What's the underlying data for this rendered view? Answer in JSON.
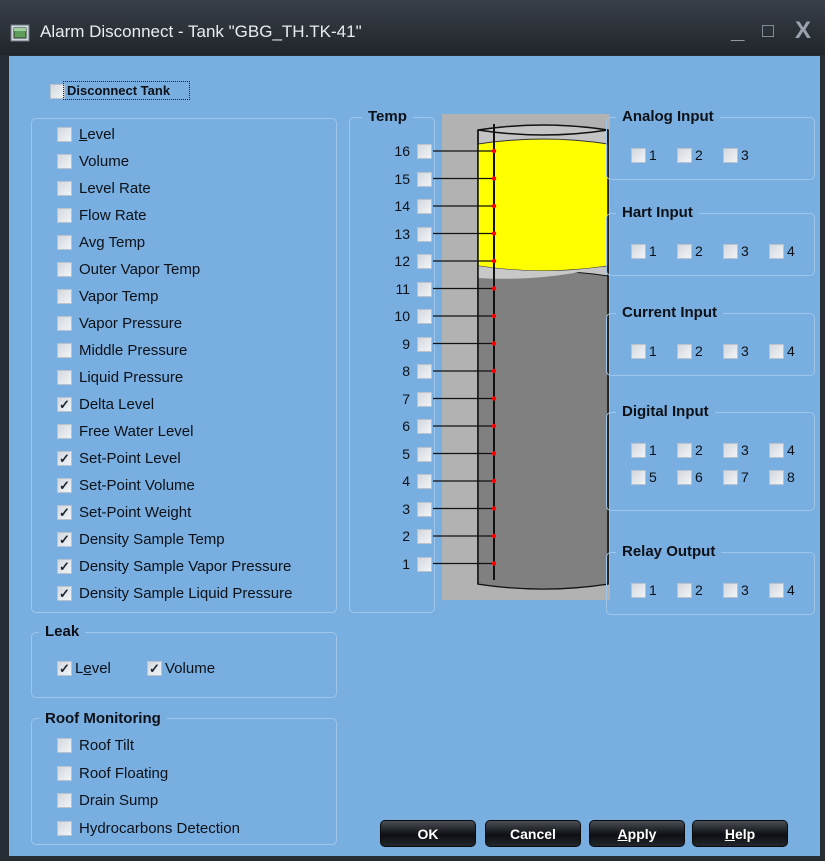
{
  "window": {
    "title": "Alarm Disconnect - Tank \"GBG_TH.TK-41\"",
    "minimize_glyph": "_",
    "maximize_glyph": "□",
    "close_glyph": "X",
    "icon": "tank-icon"
  },
  "disconnect_tank": {
    "label": "Disconnect Tank",
    "checked": false
  },
  "main_alarms": [
    {
      "label": "Level",
      "mnemonic": "L",
      "checked": false
    },
    {
      "label": "Volume",
      "checked": false
    },
    {
      "label": "Level Rate",
      "checked": false
    },
    {
      "label": "Flow Rate",
      "checked": false
    },
    {
      "label": "Avg Temp",
      "checked": false
    },
    {
      "label": "Outer Vapor Temp",
      "checked": false
    },
    {
      "label": "Vapor Temp",
      "checked": false
    },
    {
      "label": "Vapor Pressure",
      "checked": false
    },
    {
      "label": "Middle Pressure",
      "checked": false
    },
    {
      "label": "Liquid Pressure",
      "checked": false
    },
    {
      "label": "Delta Level",
      "checked": true
    },
    {
      "label": "Free  Water Level",
      "checked": false
    },
    {
      "label": "Set-Point Level",
      "checked": true
    },
    {
      "label": "Set-Point Volume",
      "checked": true
    },
    {
      "label": "Set-Point Weight",
      "checked": true
    },
    {
      "label": "Density Sample Temp",
      "checked": true
    },
    {
      "label": "Density Sample Vapor Pressure",
      "checked": true
    },
    {
      "label": "Density Sample Liquid Pressure",
      "checked": true
    }
  ],
  "leak": {
    "title": "Leak",
    "items": [
      {
        "label": "Level",
        "checked": true
      },
      {
        "label": "Volume",
        "checked": true
      }
    ]
  },
  "roof": {
    "title": "Roof Monitoring",
    "items": [
      {
        "label": "Roof Tilt",
        "checked": false
      },
      {
        "label": "Roof Floating",
        "checked": false
      },
      {
        "label": "Drain Sump",
        "checked": false
      },
      {
        "label": "Hydrocarbons Detection",
        "checked": false
      }
    ]
  },
  "temp": {
    "title": "Temp",
    "sensors": [
      "16",
      "15",
      "14",
      "13",
      "12",
      "11",
      "10",
      "9",
      "8",
      "7",
      "6",
      "5",
      "4",
      "3",
      "2",
      "1"
    ]
  },
  "tank_colors": {
    "product": "#ffff00",
    "water": "#808080",
    "shell": "#c4c4c4",
    "sensor_marker": "#ff0000"
  },
  "analog_input": {
    "title": "Analog Input",
    "channels": [
      "1",
      "2",
      "3"
    ]
  },
  "hart_input": {
    "title": "Hart Input",
    "channels": [
      "1",
      "2",
      "3",
      "4"
    ]
  },
  "current_input": {
    "title": "Current Input",
    "channels": [
      "1",
      "2",
      "3",
      "4"
    ]
  },
  "digital_input": {
    "title": "Digital Input",
    "channels": [
      "1",
      "2",
      "3",
      "4",
      "5",
      "6",
      "7",
      "8"
    ]
  },
  "relay_output": {
    "title": "Relay Output",
    "channels": [
      "1",
      "2",
      "3",
      "4"
    ]
  },
  "buttons": {
    "ok": "OK",
    "cancel": "Cancel",
    "apply": "Apply",
    "help": "Help"
  }
}
